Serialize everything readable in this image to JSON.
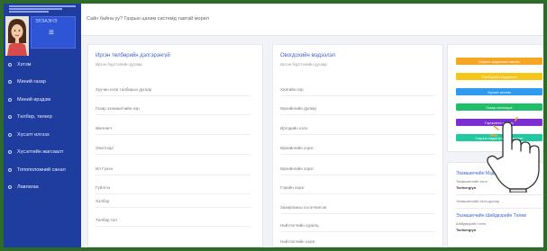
{
  "colors": {
    "sidebar": "#1f3d9e",
    "sidebar_box": "#2d55d4",
    "accent": "#3d63d8",
    "btn_orange": "#f5a623",
    "btn_yellow": "#f5c518",
    "btn_blue": "#2f9bf0",
    "btn_green": "#1fbf6a",
    "btn_purple": "#7b2fd1",
    "btn_teal": "#20c9a0"
  },
  "sidebar": {
    "user_name": "ЭЛЭАЭНЭ",
    "menu_icon": "hamburger-icon",
    "items": [
      {
        "label": "Хэтэм"
      },
      {
        "label": "Миний газар"
      },
      {
        "label": "Миний ирэдэм"
      },
      {
        "label": "Төлбөр, төлөгр"
      },
      {
        "label": "Хүсэлт илгээх"
      },
      {
        "label": "Хүсэлтийн жагсаалт"
      },
      {
        "label": "Топоположний санал"
      },
      {
        "label": "Лавлагаа"
      }
    ]
  },
  "header": {
    "greeting": "Сайн байна уу? Газрын цахим системд тавтай морил"
  },
  "left_card": {
    "title": "Иргэн төлбөрийн дэлгэрэнгүй",
    "subtitle": "Иргэн бүртгэлийн дугаар",
    "fields": [
      "Хуучин нэгж талбарын дугаар",
      "Газар эзэмшигчийн нэр",
      "Өмчлөгч",
      "Овог/нэр/",
      "Ил Гүнэн",
      "Гүйлгээ",
      "Хэлбэр",
      "Төлбөр төл"
    ]
  },
  "middle_card": {
    "title": "Овогдохийн мэдээлэл",
    "subtitle": "Иргэн бүртгэлийн дугаар",
    "fields": [
      "Хаягийн нэр",
      "Өрхийнгийн дугаар",
      "Иргэдийн хэлэ",
      "Өрхийнгийн хэрэг",
      "Өрхийнгийн хэрэг",
      "Гэрийн хэрэг",
      "Захиргааны хэсэгчилсэн",
      "Нийтлэгчийн суралц",
      "Нийтлэгчийн хэрэг"
    ]
  },
  "actions": [
    {
      "label": "Газрын мэдээлэл хэвлэх",
      "color": "#f5a623"
    },
    {
      "label": "Төлбөрийн мэдээлэл",
      "color": "#f5c518"
    },
    {
      "label": "Хүсэлт илгээх",
      "color": "#2f9bf0"
    },
    {
      "label": "Газар солилцох",
      "color": "#1fbf6a"
    },
    {
      "label": "Гэрчилгээ хэвлэх",
      "color": "#7b2fd1"
    },
    {
      "label": "Газрын кадастрын мэдээлэл",
      "color": "#20c9a0"
    }
  ],
  "contacts": {
    "title1": "Эзэмшигчийн Мэдээлэл",
    "label1": "Эзэмшигчийн хэлэ",
    "value1": "Tsetsergiyn",
    "label2": "Эзэмшигчийн хэлэ дугаар",
    "title2": "Эзэмшигчийн Шийдвэрийн Төлөв",
    "label3": "Шийдвэрийн хэлэ",
    "value3": "Tsetsergiyn"
  }
}
